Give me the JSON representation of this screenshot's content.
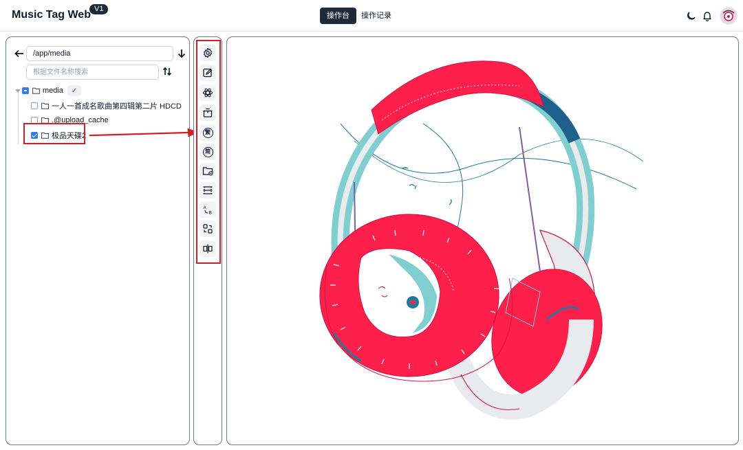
{
  "header": {
    "app_title": "Music Tag Web",
    "version": "V1",
    "tabs": [
      {
        "label": "操作台",
        "active": true
      },
      {
        "label": "操作记录",
        "active": false
      }
    ],
    "icons": [
      "moon-icon",
      "bell-icon",
      "avatar"
    ]
  },
  "file_browser": {
    "path_value": "/app/media",
    "search_placeholder": "根据文件名称搜索",
    "tree": {
      "root": {
        "label": "media",
        "state": "indeterminate",
        "confirm_glyph": "✓"
      },
      "children": [
        {
          "label": "一人一首成名歌曲第四辑第二片 HDCD",
          "checked": false
        },
        {
          "label": ".@upload_cache",
          "checked": false
        },
        {
          "label": "极品天碟2",
          "checked": true
        }
      ]
    }
  },
  "toolbar": {
    "buttons": [
      {
        "icon": "settings-icon"
      },
      {
        "icon": "edit-icon"
      },
      {
        "icon": "atom-icon"
      },
      {
        "icon": "package-icon"
      },
      {
        "icon": "traditional-chinese-icon",
        "char": "繁"
      },
      {
        "icon": "simplified-chinese-icon",
        "char": "简"
      },
      {
        "icon": "folder-minus-icon"
      },
      {
        "icon": "split-lines-icon"
      },
      {
        "icon": "transliterate-icon",
        "text": "A B"
      },
      {
        "icon": "swap-icon"
      },
      {
        "icon": "split-panel-icon"
      }
    ]
  },
  "colors": {
    "accent": "#1f2937",
    "annotation_red": "#d32027",
    "checkbox_blue": "#2f7bf5",
    "headphone_red": "#ff1f4b",
    "headphone_teal": "#7fcfd0",
    "headphone_navy": "#1e5f8c"
  }
}
